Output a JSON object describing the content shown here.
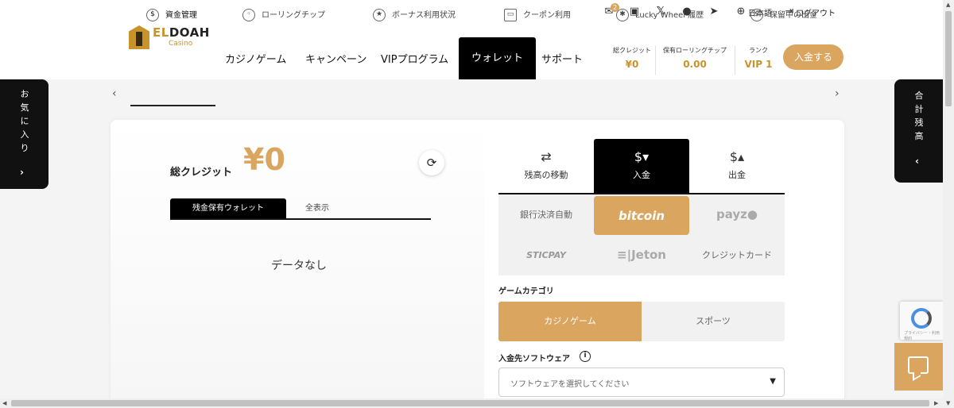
{
  "utility_bar": {
    "mail_badge": "2",
    "language": "日本語",
    "logout": "ログアウト"
  },
  "logo": {
    "brand_prefix": "EL",
    "brand_rest": "DOAH",
    "sub": "Casino"
  },
  "nav": {
    "items": [
      "カジノゲーム",
      "キャンペーン",
      "VIPプログラム",
      "ウォレット",
      "サポート"
    ],
    "active": "ウォレット"
  },
  "stats": {
    "total_credit_label": "総クレジット",
    "total_credit_value": "¥0",
    "rolling_chip_label": "保有ローリングチップ",
    "rolling_chip_value": "0.00",
    "rank_label": "ランク",
    "rank_value": "VIP 1"
  },
  "deposit_button": "入金する",
  "subnav": {
    "items": [
      "資金管理",
      "ローリングチップ",
      "ボーナス利用状況",
      "クーポン利用",
      "Lucky Wheel 履歴",
      "保留中の出金"
    ],
    "active": "資金管理"
  },
  "side_left": {
    "label_chars": [
      "お",
      "気",
      "に",
      "入",
      "り"
    ]
  },
  "side_right": {
    "label_chars": [
      "合",
      "計",
      "残",
      "高"
    ]
  },
  "wallet": {
    "total_label": "総クレジット",
    "total_value": "¥0",
    "tabs": [
      "残金保有ウォレット",
      "全表示"
    ],
    "empty_text": "データなし"
  },
  "transfer": {
    "tabs": [
      "残高の移動",
      "入金",
      "出金"
    ],
    "active_tab": "入金",
    "payment_methods": [
      "銀行決済自動",
      "bitcoin",
      "payz●",
      "STICPAY",
      "≡|Jeton",
      "クレジットカード"
    ],
    "active_method": "bitcoin",
    "game_category_label": "ゲームカテゴリ",
    "categories": [
      "カジノゲーム",
      "スポーツ"
    ],
    "software_label": "入金先ソフトウェア",
    "software_placeholder": "ソフトウェアを選択してください"
  },
  "recaptcha_text": "プライバシー・利用規約",
  "colors": {
    "accent": "#d9a55f",
    "dark": "#000000"
  }
}
